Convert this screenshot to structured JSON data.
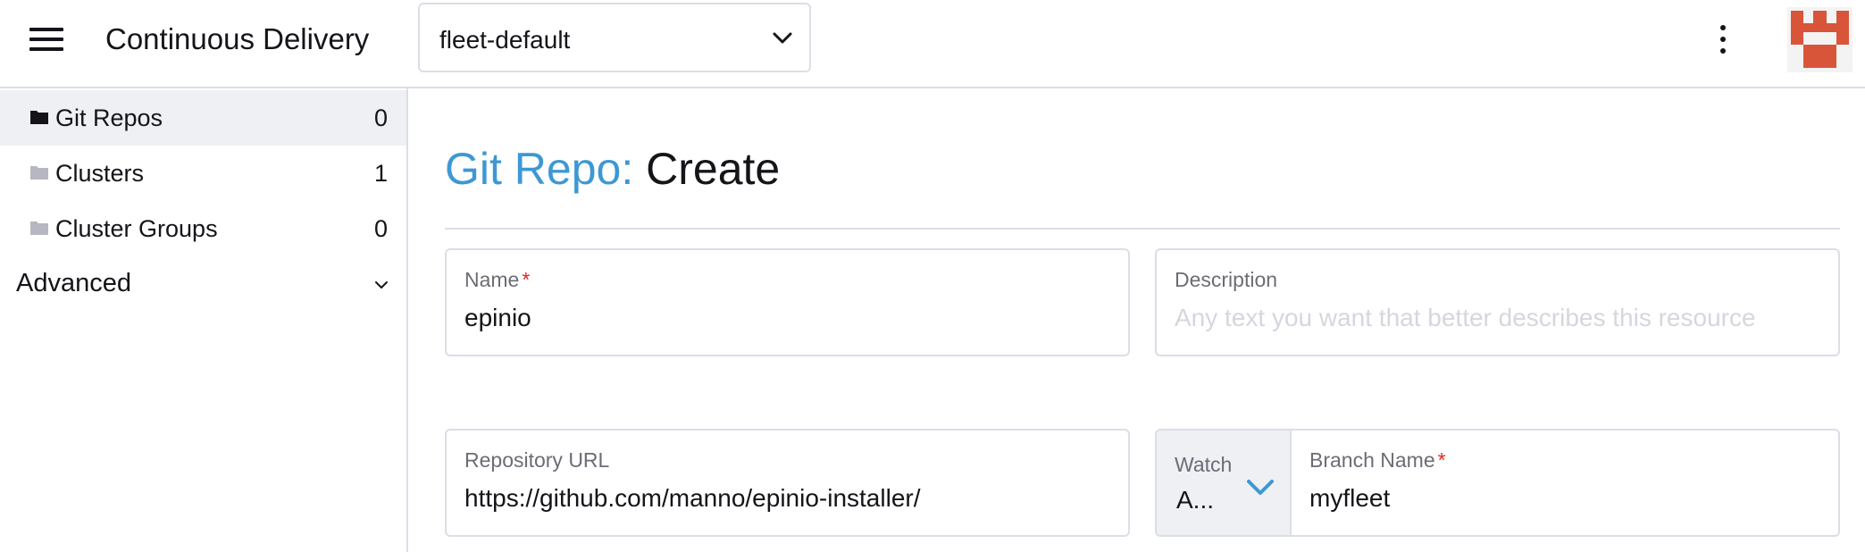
{
  "header": {
    "app_title": "Continuous Delivery",
    "workspace": "fleet-default"
  },
  "sidebar": {
    "items": [
      {
        "label": "Git Repos",
        "count": "0",
        "active": true
      },
      {
        "label": "Clusters",
        "count": "1",
        "active": false
      },
      {
        "label": "Cluster Groups",
        "count": "0",
        "active": false
      }
    ],
    "group": {
      "label": "Advanced"
    }
  },
  "main": {
    "breadcrumb": "Git Repo:",
    "action": "Create",
    "name_field": {
      "label": "Name",
      "required_mark": "*",
      "value": "epinio"
    },
    "description_field": {
      "label": "Description",
      "placeholder": "Any text you want that better describes this resource"
    },
    "repo_url_field": {
      "label": "Repository URL",
      "value": "https://github.com/manno/epinio-installer/"
    },
    "watch_select": {
      "label": "Watch",
      "value": "A..."
    },
    "branch_field": {
      "label": "Branch Name",
      "required_mark": "*",
      "value": "myfleet"
    }
  },
  "colors": {
    "accent": "#3d98d3",
    "required": "#e32626",
    "avatar_primary": "#d8553a",
    "sidebar_active": "#eef0f4"
  },
  "icons": {
    "menu": "hamburger-icon",
    "workspace_dropdown": "chevron-down-icon",
    "more": "kebab-menu-icon",
    "nav_folder": "folder-icon",
    "group_toggle": "chevron-down-icon"
  }
}
